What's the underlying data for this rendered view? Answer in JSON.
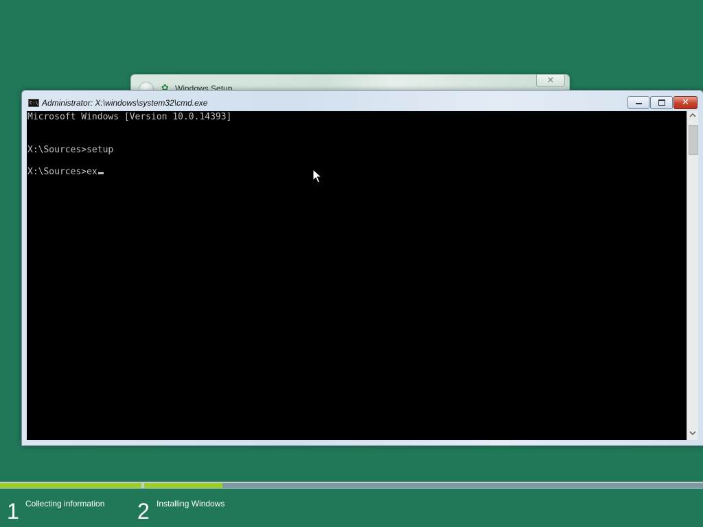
{
  "background_color": "#207858",
  "setup_window": {
    "title": "Windows Setup",
    "close_glyph": "✕",
    "logo_icon": "windows-setup-icon"
  },
  "cmd_window": {
    "title": "Administrator: X:\\windows\\system32\\cmd.exe",
    "icon": "console-icon",
    "buttons": {
      "minimize": "minimize-icon",
      "maximize": "maximize-icon",
      "close": "✕"
    },
    "lines": [
      "Microsoft Windows [Version 10.0.14393]",
      "",
      "X:\\Sources>setup",
      "X:\\Sources>ex"
    ]
  },
  "steps": [
    {
      "number": "1",
      "label": "Collecting information",
      "progress": 1.0
    },
    {
      "number": "2",
      "label": "Installing Windows",
      "progress": 0.14
    }
  ],
  "colors": {
    "progress_fill": "#9bd02c",
    "progress_empty": "#7f9aa6",
    "console_bg": "#000000",
    "console_text": "#c0c0c0"
  }
}
